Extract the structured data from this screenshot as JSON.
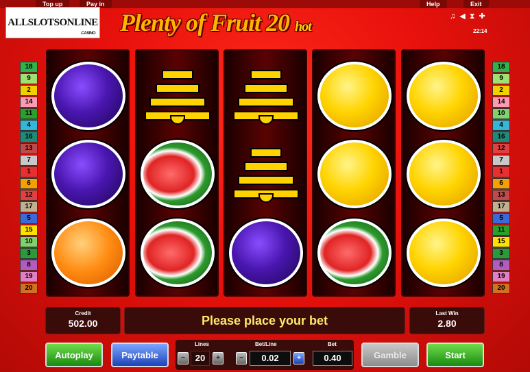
{
  "topbar": {
    "top_up": "Top up",
    "pay_in": "Pay in",
    "help": "Help",
    "exit": "Exit"
  },
  "logo": {
    "text": "ALLSLOTSONLINE",
    "sub": ".CASINO"
  },
  "title": {
    "main": "Plenty of Fruit",
    "num": "20",
    "hot": "hot"
  },
  "system": {
    "clock": "22:14",
    "icons": [
      "music-icon",
      "sound-icon",
      "settings-icon",
      "fullscreen-icon"
    ]
  },
  "paylines_left": [
    {
      "n": "18",
      "color": "#2fb34a"
    },
    {
      "n": "9",
      "color": "#a0e070"
    },
    {
      "n": "2",
      "color": "#f2d000"
    },
    {
      "n": "14",
      "color": "#ff9ab3"
    },
    {
      "n": "11",
      "color": "#2aa02a"
    },
    {
      "n": "4",
      "color": "#35b6d8"
    },
    {
      "n": "16",
      "color": "#1f8a7a"
    },
    {
      "n": "13",
      "color": "#c04a4a"
    },
    {
      "n": "7",
      "color": "#c8c8c8"
    },
    {
      "n": "1",
      "color": "#e83030"
    },
    {
      "n": "6",
      "color": "#f5a000"
    },
    {
      "n": "12",
      "color": "#e24040"
    },
    {
      "n": "17",
      "color": "#c0b090"
    },
    {
      "n": "5",
      "color": "#3a6ad8"
    },
    {
      "n": "15",
      "color": "#ffe000"
    },
    {
      "n": "10",
      "color": "#7ed46a"
    },
    {
      "n": "3",
      "color": "#2b9a3b"
    },
    {
      "n": "8",
      "color": "#b25cc0"
    },
    {
      "n": "19",
      "color": "#e080c0"
    },
    {
      "n": "20",
      "color": "#d07020"
    }
  ],
  "paylines_right": [
    {
      "n": "18",
      "color": "#2fb34a"
    },
    {
      "n": "9",
      "color": "#a0e070"
    },
    {
      "n": "2",
      "color": "#f2d000"
    },
    {
      "n": "14",
      "color": "#ff9ab3"
    },
    {
      "n": "10",
      "color": "#7ed46a"
    },
    {
      "n": "4",
      "color": "#35b6d8"
    },
    {
      "n": "16",
      "color": "#1f8a7a"
    },
    {
      "n": "12",
      "color": "#e24040"
    },
    {
      "n": "7",
      "color": "#c8c8c8"
    },
    {
      "n": "1",
      "color": "#e83030"
    },
    {
      "n": "6",
      "color": "#f5a000"
    },
    {
      "n": "13",
      "color": "#c04a4a"
    },
    {
      "n": "17",
      "color": "#c0b090"
    },
    {
      "n": "5",
      "color": "#3a6ad8"
    },
    {
      "n": "11",
      "color": "#2aa02a"
    },
    {
      "n": "15",
      "color": "#ffe000"
    },
    {
      "n": "3",
      "color": "#2b9a3b"
    },
    {
      "n": "8",
      "color": "#b25cc0"
    },
    {
      "n": "19",
      "color": "#e080c0"
    },
    {
      "n": "20",
      "color": "#d07020"
    }
  ],
  "reels": [
    [
      "plum",
      "plum",
      "orange"
    ],
    [
      "bell",
      "melon",
      "melon"
    ],
    [
      "bell",
      "bell",
      "plum"
    ],
    [
      "lemon",
      "lemon",
      "melon"
    ],
    [
      "lemon",
      "lemon",
      "lemon"
    ]
  ],
  "panel": {
    "credit_label": "Credit",
    "credit_value": "502.00",
    "message": "Please place your bet",
    "lastwin_label": "Last Win",
    "lastwin_value": "2.80"
  },
  "controls": {
    "autoplay": "Autoplay",
    "paytable": "Paytable",
    "gamble": "Gamble",
    "start": "Start",
    "lines_label": "Lines",
    "lines_value": "20",
    "betline_label": "Bet/Line",
    "betline_value": "0.02",
    "bet_label": "Bet",
    "bet_value": "0.40",
    "minus": "−",
    "plus": "+"
  }
}
